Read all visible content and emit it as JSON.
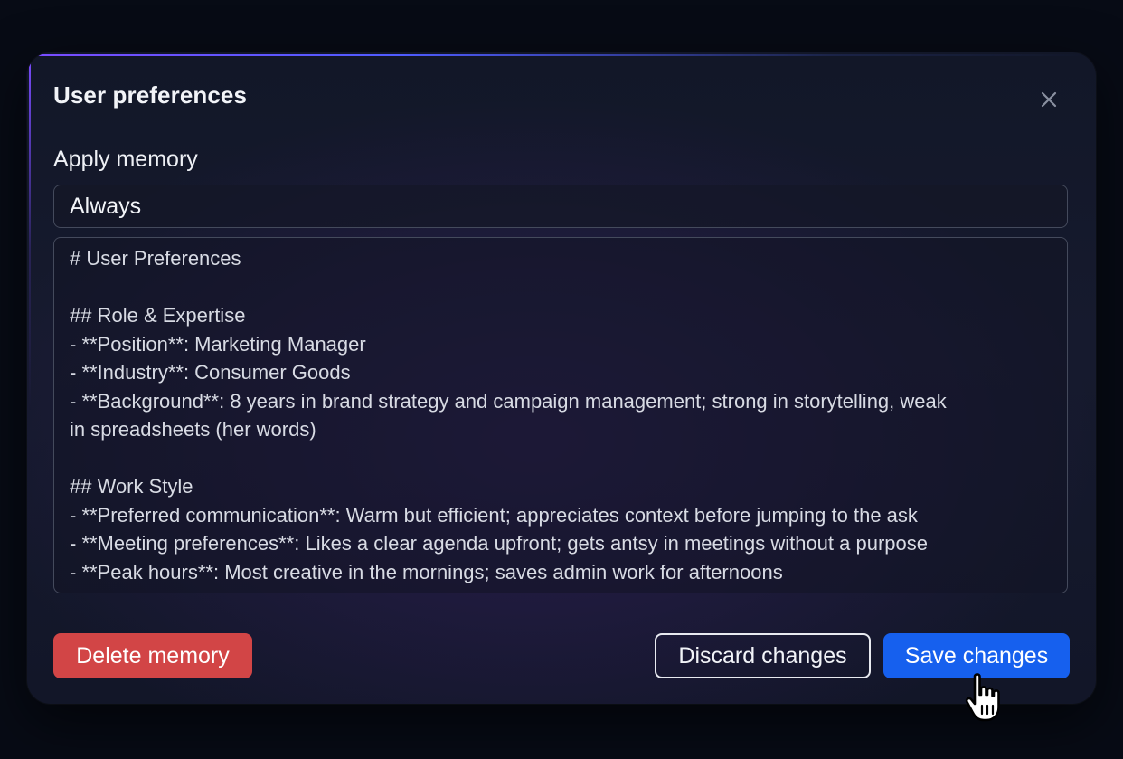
{
  "dialog": {
    "title": "User preferences",
    "close_icon": "close-icon"
  },
  "apply_memory": {
    "label": "Apply memory",
    "selected_value": "Always"
  },
  "memory_text": {
    "lines": [
      "# User Preferences",
      "",
      "## Role & Expertise",
      "- **Position**: Marketing Manager",
      "- **Industry**: Consumer Goods",
      "- **Background**: 8 years in brand strategy and campaign management; strong in storytelling, weak",
      "in spreadsheets (her words)",
      "",
      "## Work Style",
      "- **Preferred communication**: Warm but efficient; appreciates context before jumping to the ask",
      "- **Meeting preferences**: Likes a clear agenda upfront; gets antsy in meetings without a purpose",
      "- **Peak hours**: Most creative in the mornings; saves admin work for afternoons"
    ]
  },
  "actions": {
    "delete_label": "Delete memory",
    "discard_label": "Discard changes",
    "save_label": "Save changes"
  },
  "colors": {
    "delete": "#d24546",
    "save": "#1660ee",
    "accent_border": "#7a4cff"
  },
  "cursor_icon": "hand-pointer-icon"
}
